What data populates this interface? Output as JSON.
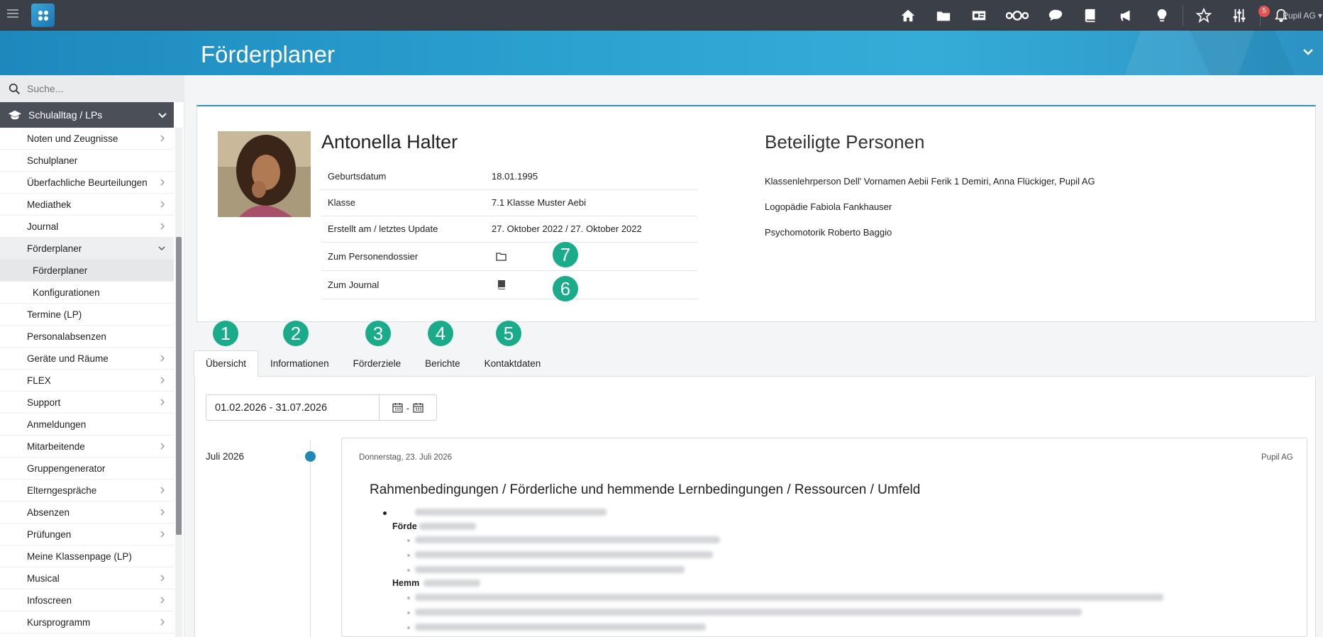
{
  "topbar": {
    "user_label": "Pupil AG ▾",
    "notification_count": "5",
    "icons": [
      "home-icon",
      "folder-icon",
      "id-card-icon",
      "nextcloud-icon",
      "chat-icon",
      "book-icon",
      "megaphone-icon",
      "lightbulb-icon",
      "star-icon",
      "sliders-icon",
      "bell-icon"
    ]
  },
  "banner": {
    "title": "Förderplaner"
  },
  "sidebar": {
    "search_placeholder": "Suche...",
    "section_label": "Schulalltag / LPs",
    "items": [
      {
        "label": "Noten und Zeugnisse"
      },
      {
        "label": "Schulplaner"
      },
      {
        "label": "Überfachliche Beurteilungen"
      },
      {
        "label": "Mediathek"
      },
      {
        "label": "Journal"
      },
      {
        "label": "Förderplaner"
      },
      {
        "label": "Förderplaner"
      },
      {
        "label": "Konfigurationen"
      },
      {
        "label": "Termine (LP)"
      },
      {
        "label": "Personalabsenzen"
      },
      {
        "label": "Geräte und Räume"
      },
      {
        "label": "FLEX"
      },
      {
        "label": "Support"
      },
      {
        "label": "Anmeldungen"
      },
      {
        "label": "Mitarbeitende"
      },
      {
        "label": "Gruppengenerator"
      },
      {
        "label": "Elterngespräche"
      },
      {
        "label": "Absenzen"
      },
      {
        "label": "Prüfungen"
      },
      {
        "label": "Meine Klassenpage (LP)"
      },
      {
        "label": "Musical"
      },
      {
        "label": "Infoscreen"
      },
      {
        "label": "Kursprogramm"
      }
    ]
  },
  "student": {
    "name": "Antonella Halter",
    "rows": [
      {
        "label": "Geburtsdatum",
        "value": "18.01.1995"
      },
      {
        "label": "Klasse",
        "value": "7.1 Klasse Muster Aebi"
      },
      {
        "label": "Erstellt am / letztes Update",
        "value": "27. Oktober 2022 / 27. Oktober 2022"
      },
      {
        "label": "Zum Personendossier",
        "value": ""
      },
      {
        "label": "Zum Journal",
        "value": ""
      }
    ]
  },
  "participants": {
    "title": "Beteiligte Personen",
    "people": [
      "Klassenlehrperson Dell' Vornamen Aebii Ferik 1 Demiri, Anna Flückiger, Pupil AG",
      "Logopädie Fabiola Fankhauser",
      "Psychomotorik Roberto Baggio"
    ]
  },
  "markers": [
    "1",
    "2",
    "3",
    "4",
    "5",
    "6",
    "7"
  ],
  "tabs": [
    {
      "label": "Übersicht",
      "active": true
    },
    {
      "label": "Informationen"
    },
    {
      "label": "Förderziele"
    },
    {
      "label": "Berichte"
    },
    {
      "label": "Kontaktdaten"
    }
  ],
  "filter": {
    "date_range": "01.02.2026 - 31.07.2026",
    "separator": "-"
  },
  "timeline": {
    "month": "Juli 2026",
    "entry": {
      "date": "Donnerstag, 23. Juli 2026",
      "author": "Pupil AG",
      "title": "Rahmenbedingungen / Förderliche und hemmende Lernbedingungen / Ressourcen / Umfeld",
      "heading_1": "Förde",
      "heading_2": "Hemm"
    }
  },
  "colors": {
    "topbar": "#3b3f47",
    "banner": "#2aa0cf",
    "accent": "#1f88b7",
    "marker": "#1aab8a",
    "badge": "#e55353"
  }
}
